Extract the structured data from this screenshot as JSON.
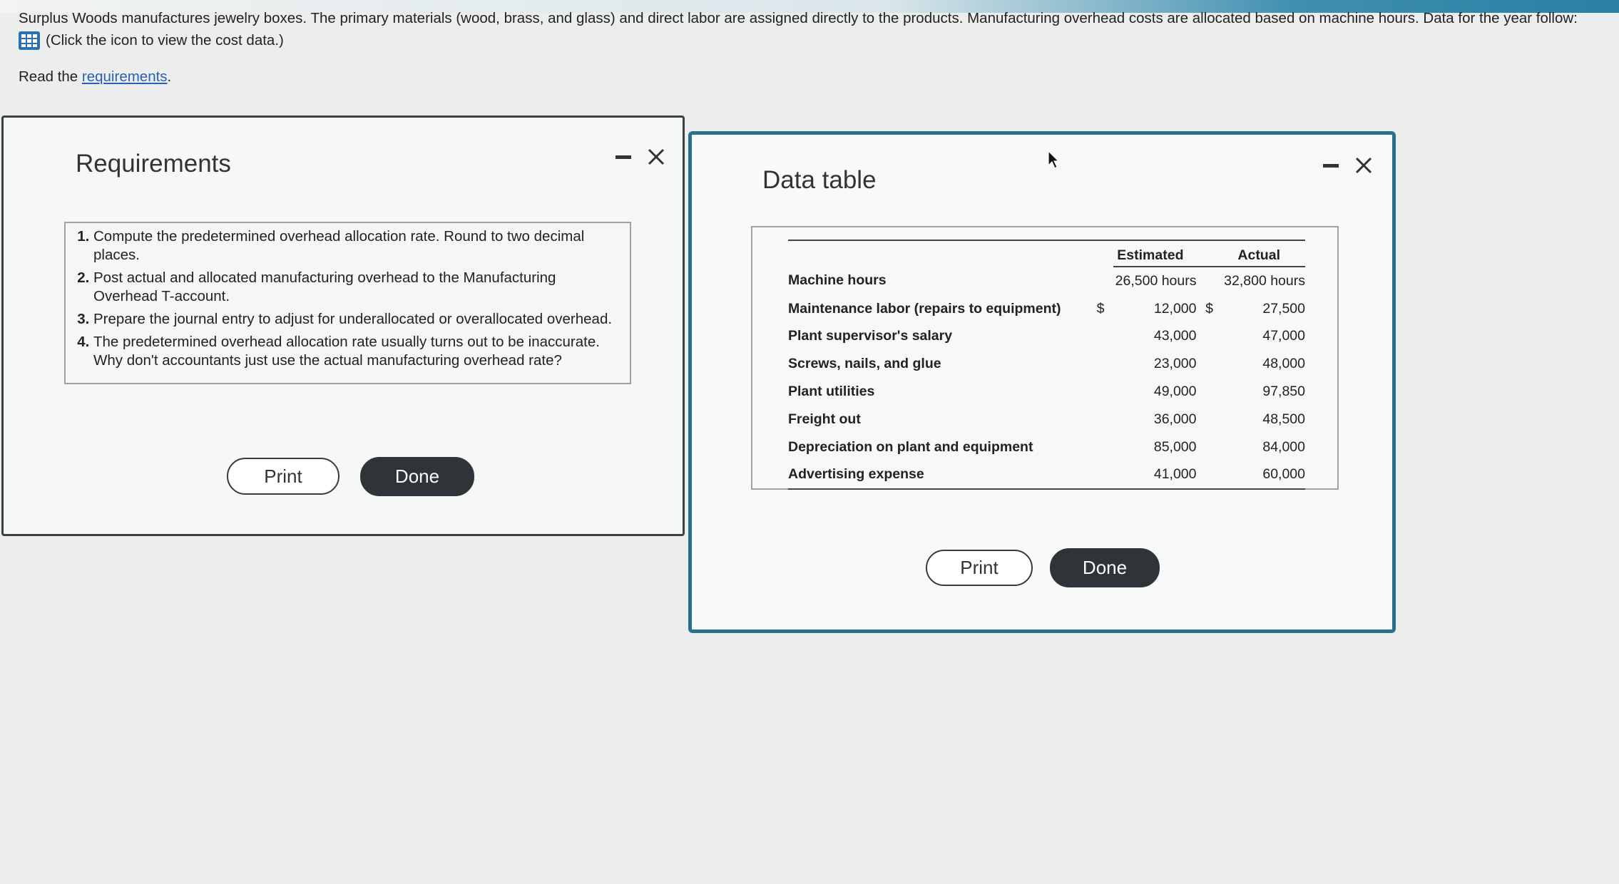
{
  "problem": {
    "text": "Surplus Woods manufactures jewelry boxes. The primary materials (wood, brass, and glass) and direct labor are assigned directly to the products. Manufacturing overhead costs are allocated based on machine hours. Data for the year follow:",
    "click_hint": "(Click the icon to view the cost data.)",
    "grid_icon": "table-grid-icon",
    "read_prefix": "Read the",
    "read_link": "requirements",
    "read_suffix": "."
  },
  "requirements_panel": {
    "title": "Requirements",
    "items": [
      "Compute the predetermined overhead allocation rate. Round to two decimal places.",
      "Post actual and allocated manufacturing overhead to the Manufacturing Overhead T-account.",
      "Prepare the journal entry to adjust for underallocated or overallocated overhead.",
      "The predetermined overhead allocation rate usually turns out to be inaccurate. Why don't accountants just use the actual manufacturing overhead rate?"
    ],
    "print_label": "Print",
    "done_label": "Done"
  },
  "data_panel": {
    "title": "Data table",
    "columns": [
      "Estimated",
      "Actual"
    ],
    "rows": [
      {
        "label": "Machine hours",
        "cur1": "",
        "estimated": "26,500 hours",
        "cur2": "",
        "actual": "32,800 hours"
      },
      {
        "label": "Maintenance labor (repairs to equipment)",
        "cur1": "$",
        "estimated": "12,000",
        "cur2": "$",
        "actual": "27,500"
      },
      {
        "label": "Plant supervisor's salary",
        "cur1": "",
        "estimated": "43,000",
        "cur2": "",
        "actual": "47,000"
      },
      {
        "label": "Screws, nails, and glue",
        "cur1": "",
        "estimated": "23,000",
        "cur2": "",
        "actual": "48,000"
      },
      {
        "label": "Plant utilities",
        "cur1": "",
        "estimated": "49,000",
        "cur2": "",
        "actual": "97,850"
      },
      {
        "label": "Freight out",
        "cur1": "",
        "estimated": "36,000",
        "cur2": "",
        "actual": "48,500"
      },
      {
        "label": "Depreciation on plant and equipment",
        "cur1": "",
        "estimated": "85,000",
        "cur2": "",
        "actual": "84,000"
      },
      {
        "label": "Advertising expense",
        "cur1": "",
        "estimated": "41,000",
        "cur2": "",
        "actual": "60,000"
      }
    ],
    "print_label": "Print",
    "done_label": "Done"
  },
  "colors": {
    "accent": "#2b6f8c",
    "link": "#2a5fb5",
    "done_button": "#2f3438"
  }
}
